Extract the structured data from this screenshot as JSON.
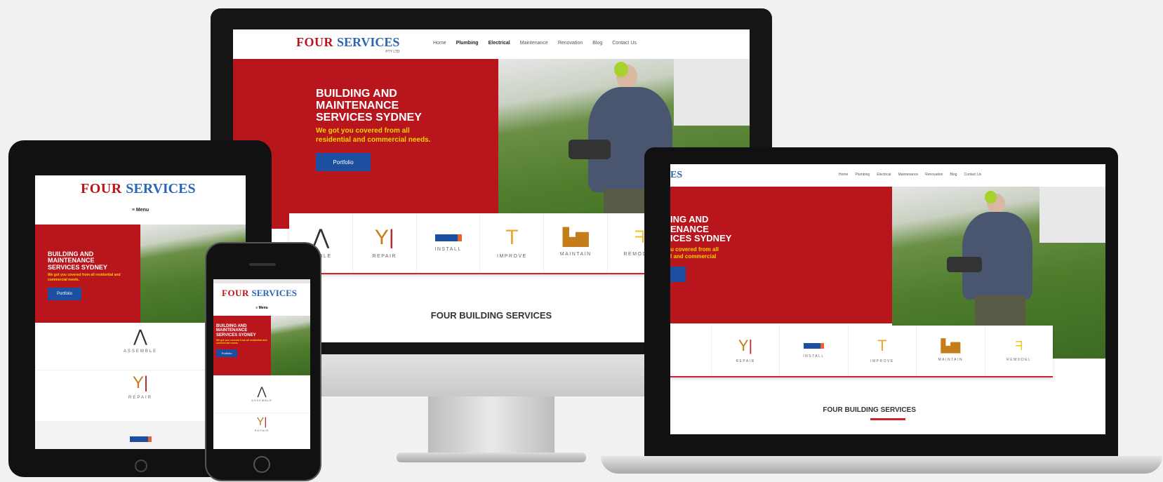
{
  "brand": {
    "four": "FOUR",
    "services": "SERVICES",
    "four_mobile": "FOUR SE",
    "services_mobile": "RVICES",
    "sub": "PTY LTD"
  },
  "nav": [
    "Home",
    "Plumbing",
    "Electrical",
    "Maintenance",
    "Renovation",
    "Blog",
    "Contact Us"
  ],
  "menu_label": "≡ Menu",
  "hero": {
    "heading_line1": "BUILDING AND",
    "heading_line2": "MAINTENANCE",
    "heading_line3": "SERVICES SYDNEY",
    "heading_line3_partial": "ICES SYDNEY",
    "heading_line1_partial": "ING AND",
    "heading_line2_partial": "ENANCE",
    "text": "We got you covered from all residential and commercial needs.",
    "text_partial": "u covered from all\nl and commercial",
    "button": "Portfolio"
  },
  "services": [
    {
      "label": "ASSEMBLE",
      "label_cut": "EMBLE",
      "icon": "pliers-icon"
    },
    {
      "label": "REPAIR",
      "icon": "tools-icon"
    },
    {
      "label": "INSTALL",
      "icon": "drill-icon"
    },
    {
      "label": "IMPROVE",
      "icon": "paint-roller-icon"
    },
    {
      "label": "MAINTAIN",
      "icon": "paint-bucket-icon"
    },
    {
      "label": "REMODEL",
      "icon": "nail-gun-icon"
    }
  ],
  "section_title": "FOUR BUILDING SERVICES",
  "colors": {
    "brand_red": "#b8151d",
    "brand_blue": "#1d4fa0",
    "accent_yellow": "#f6d400"
  }
}
